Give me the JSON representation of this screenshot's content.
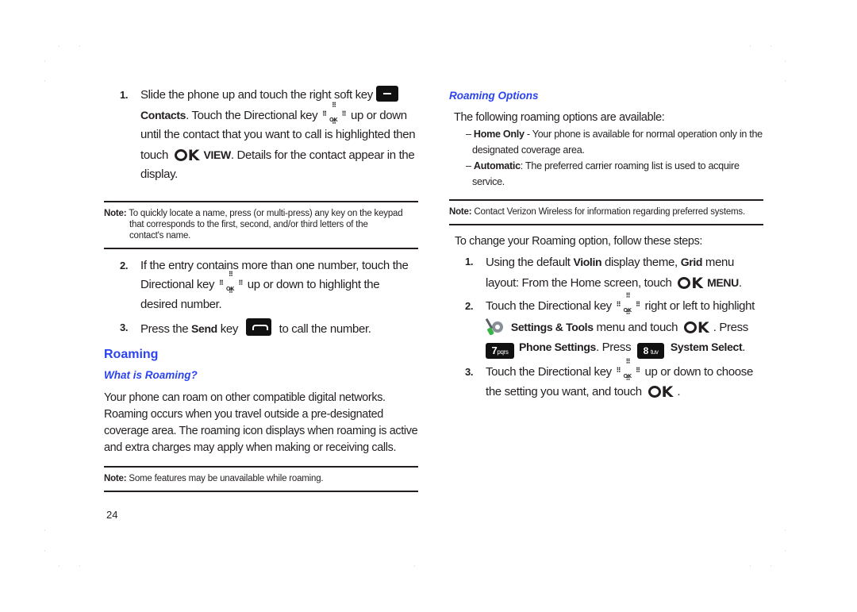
{
  "page_number": "24",
  "left": {
    "step1": {
      "num": "1.",
      "t1": "Slide the phone up and touch the right soft key",
      "contacts": "Contacts",
      "t2": ". Touch the Directional key",
      "t3": "up or down until the contact that you want to call is highlighted then touch",
      "view": "VIEW",
      "t4": ". Details for the contact appear in the display."
    },
    "note1": {
      "label": "Note:",
      "text_line1": "To quickly locate a name, press (or multi-press) any key on the keypad",
      "text_line2": "that corresponds to the first, second, and/or third letters of the",
      "text_line3": "contact's name."
    },
    "step2": {
      "num": "2.",
      "t1": "If the entry contains more than one number, touch the Directional key",
      "t2": "up or down to highlight the desired number."
    },
    "step3": {
      "num": "3.",
      "t1": "Press the",
      "send": "Send",
      "t2": "key",
      "t3": "to call the number."
    },
    "section_title": "Roaming",
    "subsection_title": "What is Roaming?",
    "paragraph": "Your phone can roam on other compatible digital networks. Roaming occurs when you travel outside a pre-designated coverage area. The roaming icon displays when roaming is active and extra charges may apply when making or receiving calls.",
    "note2": {
      "label": "Note:",
      "text": "Some features may be unavailable while roaming."
    }
  },
  "right": {
    "subsection_title": "Roaming Options",
    "intro": "The following roaming options are available:",
    "options": [
      {
        "dash": "–",
        "name": "Home Only",
        "text": " - Your phone is available for normal operation only in the designated coverage area."
      },
      {
        "dash": "–",
        "name": "Automatic",
        "text": ": The preferred carrier roaming list is used to acquire service."
      }
    ],
    "note": {
      "label": "Note:",
      "text": "Contact Verizon Wireless for information regarding preferred systems."
    },
    "steps_intro": "To change your Roaming option, follow these steps:",
    "step1": {
      "num": "1.",
      "t1": "Using the default",
      "violin": "Violin",
      "t2": "display theme,",
      "grid": "Grid",
      "t3": "menu layout: From the Home screen, touch",
      "menu": "MENU",
      "t4": "."
    },
    "step2": {
      "num": "2.",
      "t1": "Touch the Directional key",
      "t2": "right or left to highlight",
      "settings": "Settings & Tools",
      "t3": "menu and touch",
      "t4": ". Press",
      "phone_settings": "Phone Settings",
      "t5": ". Press",
      "system_select": "System Select",
      "t6": "."
    },
    "step3": {
      "num": "3.",
      "t1": "Touch the Directional key",
      "t2": "up or down to choose the setting you want, and touch",
      "t3": "."
    }
  },
  "icons": {
    "ok_label": "OK",
    "ok_letter_k": "K",
    "key7_digit": "7",
    "key7_letters": "pqrs",
    "key8_digit": "8",
    "key8_letters": "tuv",
    "hash": "⠿"
  }
}
